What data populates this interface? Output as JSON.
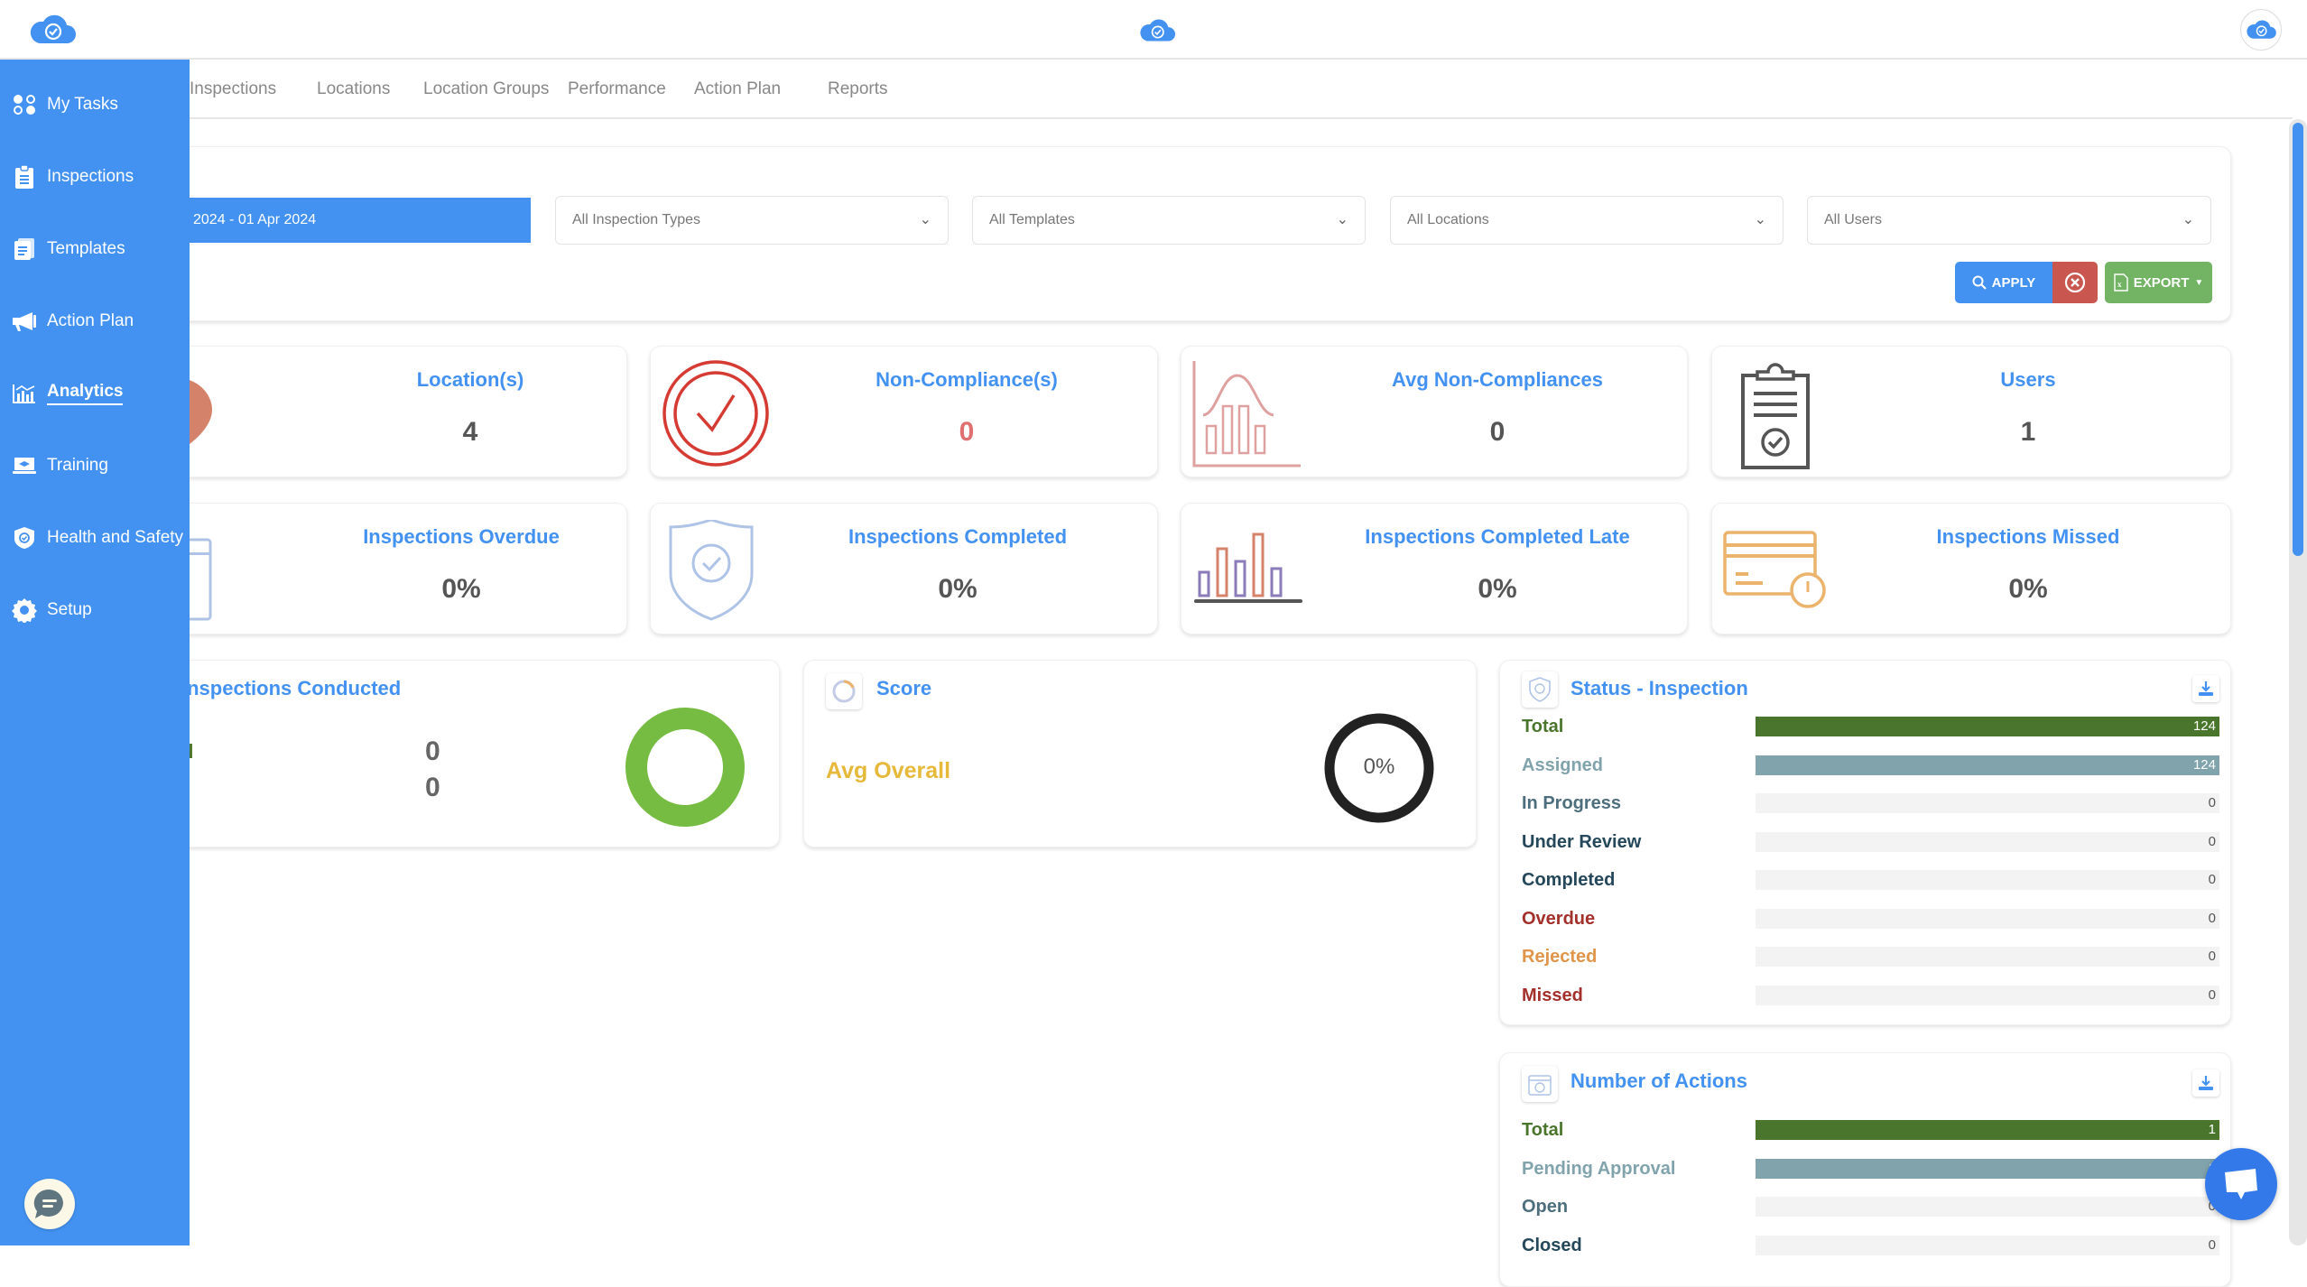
{
  "header": {
    "logo_icon": "cloud-check-icon",
    "center_logo_icon": "cloud-check-icon",
    "avatar_icon": "cloud-check-icon"
  },
  "tabs": [
    {
      "label": "Inspections"
    },
    {
      "label": "Locations"
    },
    {
      "label": "Location Groups"
    },
    {
      "label": "Performance"
    },
    {
      "label": "Action Plan"
    },
    {
      "label": "Reports"
    }
  ],
  "sidebar": {
    "items": [
      {
        "label": "My Tasks",
        "icon": "dots-grid-icon"
      },
      {
        "label": "Inspections",
        "icon": "clipboard-icon"
      },
      {
        "label": "Templates",
        "icon": "documents-icon"
      },
      {
        "label": "Action Plan",
        "icon": "megaphone-icon"
      },
      {
        "label": "Analytics",
        "icon": "chart-icon",
        "active": true
      },
      {
        "label": "Training",
        "icon": "laptop-graduation-icon"
      },
      {
        "label": "Health and Safety",
        "icon": "shield-check-icon"
      },
      {
        "label": "Setup",
        "icon": "gear-icon"
      }
    ],
    "chat_icon": "chat-bubble-icon"
  },
  "filters": {
    "date_range": "2024 - 01 Apr 2024",
    "inspection_types": "All Inspection Types",
    "templates": "All Templates",
    "locations": "All Locations",
    "users": "All Users",
    "apply_label": "APPLY",
    "export_label": "EXPORT"
  },
  "stats": [
    {
      "title": "Location(s)",
      "value": "4",
      "icon": "location-pin-icon"
    },
    {
      "title": "Non-Compliance(s)",
      "value": "0",
      "icon": "check-circle-icon"
    },
    {
      "title": "Avg Non-Compliances",
      "value": "0",
      "icon": "bell-curve-chart-icon"
    },
    {
      "title": "Users",
      "value": "1",
      "icon": "clipboard-check-icon"
    },
    {
      "title": "Inspections Overdue",
      "value": "0%",
      "icon": "calendar-icon"
    },
    {
      "title": "Inspections Completed",
      "value": "0%",
      "icon": "shield-check-icon"
    },
    {
      "title": "Inspections Completed Late",
      "value": "0%",
      "icon": "bar-chart-icon"
    },
    {
      "title": "Inspections Missed",
      "value": "0%",
      "icon": "card-clock-icon"
    }
  ],
  "inspections_conducted": {
    "title": "Inspections Conducted",
    "rows": [
      {
        "label": "d",
        "value": "0"
      },
      {
        "label": "",
        "value": "0"
      }
    ]
  },
  "score": {
    "title": "Score",
    "avg_label": "Avg Overall",
    "avg_value": "0%"
  },
  "status_inspection": {
    "title": "Status - Inspection",
    "max": 124,
    "rows": [
      {
        "label": "Total",
        "value": 124,
        "label_color": "#4a752c",
        "bar_color": "#4a752c"
      },
      {
        "label": "Assigned",
        "value": 124,
        "label_color": "#80a3ac",
        "bar_color": "#80a3ac"
      },
      {
        "label": "In Progress",
        "value": 0,
        "label_color": "#4d6f7d",
        "bar_color": "#4d6f7d"
      },
      {
        "label": "Under Review",
        "value": 0,
        "label_color": "#24475a",
        "bar_color": "#24475a"
      },
      {
        "label": "Completed",
        "value": 0,
        "label_color": "#24475a",
        "bar_color": "#24475a"
      },
      {
        "label": "Overdue",
        "value": 0,
        "label_color": "#a3302b",
        "bar_color": "#a3302b"
      },
      {
        "label": "Rejected",
        "value": 0,
        "label_color": "#e0954a",
        "bar_color": "#e0954a"
      },
      {
        "label": "Missed",
        "value": 0,
        "label_color": "#a3302b",
        "bar_color": "#a3302b"
      }
    ]
  },
  "number_of_actions": {
    "title": "Number of Actions",
    "max": 1,
    "rows": [
      {
        "label": "Total",
        "value": 1,
        "label_color": "#4a752c",
        "bar_color": "#4a752c"
      },
      {
        "label": "Pending Approval",
        "value": 1,
        "label_color": "#80a3ac",
        "bar_color": "#80a3ac"
      },
      {
        "label": "Open",
        "value": 0,
        "label_color": "#4d6f7d",
        "bar_color": "#4d6f7d"
      },
      {
        "label": "Closed",
        "value": 0,
        "label_color": "#24475a",
        "bar_color": "#24475a"
      }
    ]
  },
  "colors": {
    "primary": "#4392f1",
    "danger": "#c9574f",
    "success": "#72b464",
    "score_yellow": "#e6b93a",
    "donut_green": "#76bc42"
  }
}
